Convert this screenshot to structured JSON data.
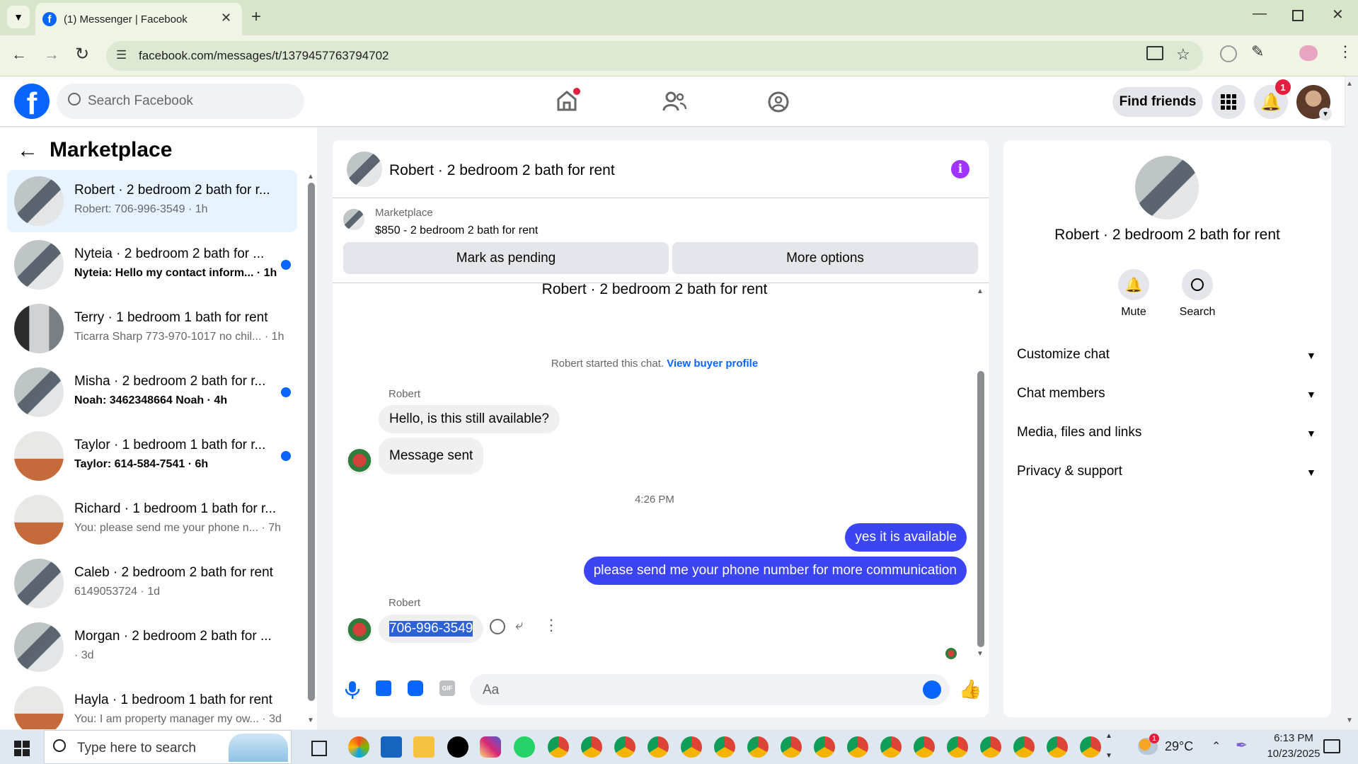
{
  "browser": {
    "tab_title": "(1) Messenger | Facebook",
    "url": "facebook.com/messages/t/1379457763794702"
  },
  "header": {
    "search_placeholder": "Search Facebook",
    "find_friends": "Find friends",
    "notification_count": "1"
  },
  "left": {
    "title": "Marketplace",
    "conversations": [
      {
        "title": "Robert · 2 bedroom 2 bath for r...",
        "preview": "Robert: 706-996-3549 · 1h",
        "unread": false,
        "active": true
      },
      {
        "title": "Nyteia · 2 bedroom 2 bath for ...",
        "preview": "Nyteia: Hello my contact inform... · 1h",
        "unread": true,
        "active": false
      },
      {
        "title": "Terry · 1 bedroom 1 bath for rent",
        "preview": "Ticarra Sharp 773-970-1017 no chil... · 1h",
        "unread": false,
        "active": false
      },
      {
        "title": "Misha · 2 bedroom 2 bath for r...",
        "preview": "Noah: 3462348664 Noah · 4h",
        "unread": true,
        "active": false
      },
      {
        "title": "Taylor · 1 bedroom 1 bath for r...",
        "preview": "Taylor: 614-584-7541 · 6h",
        "unread": true,
        "active": false
      },
      {
        "title": "Richard · 1 bedroom 1 bath for r...",
        "preview": "You: please send me your phone n... · 7h",
        "unread": false,
        "active": false
      },
      {
        "title": "Caleb · 2 bedroom 2 bath for rent",
        "preview": "6149053724 · 1d",
        "unread": false,
        "active": false
      },
      {
        "title": "Morgan · 2 bedroom 2 bath for ...",
        "preview": "· 3d",
        "unread": false,
        "active": false
      },
      {
        "title": "Hayla · 1 bedroom 1 bath for rent",
        "preview": "You: I am property manager my ow... · 3d",
        "unread": false,
        "active": false
      }
    ]
  },
  "chat": {
    "title": "Robert · 2 bedroom 2 bath for rent",
    "listing_source": "Marketplace",
    "listing_text": "$850 - 2 bedroom 2 bath for rent",
    "mark_pending": "Mark as pending",
    "more_options": "More options",
    "thread_heading": "Robert · 2 bedroom 2 bath for rent",
    "started_text": "Robert started this chat.",
    "view_buyer": "View buyer profile",
    "sender_name": "Robert",
    "msg1": "Hello, is this still available?",
    "msg2": "Message sent",
    "time": "4:26 PM",
    "out1": "yes it is available",
    "out2": "please send me your phone number for more communication",
    "sender_name2": "Robert",
    "phone_msg": "706-996-3549",
    "input_placeholder": "Aa"
  },
  "right": {
    "title": "Robert · 2 bedroom 2 bath for rent",
    "mute": "Mute",
    "search": "Search",
    "sections": [
      "Customize chat",
      "Chat members",
      "Media, files and links",
      "Privacy & support"
    ]
  },
  "taskbar": {
    "search_placeholder": "Type here to search",
    "weather": "29°C",
    "time": "6:13 PM",
    "date": "10/23/2025",
    "weather_badge": "1"
  },
  "colors": {
    "fb_blue": "#0866ff",
    "outgoing_bubble": "#3b45f4",
    "info_purple": "#a033ff"
  }
}
